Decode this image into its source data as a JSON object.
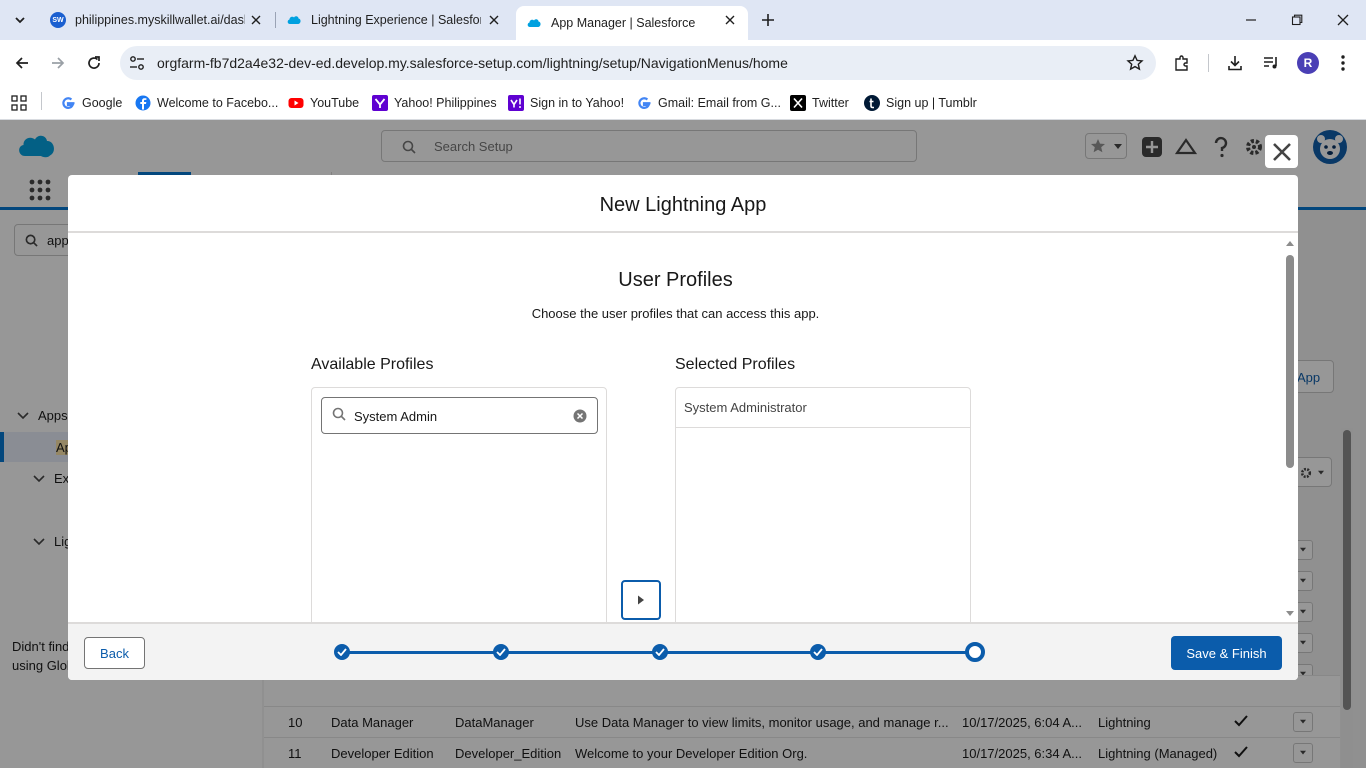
{
  "browser": {
    "tabs": [
      {
        "title": "philippines.myskillwallet.ai/dash",
        "favicon": "SW"
      },
      {
        "title": "Lightning Experience | Salesforce",
        "favicon": "salesforce-cloud"
      },
      {
        "title": "App Manager | Salesforce",
        "favicon": "salesforce-cloud"
      }
    ],
    "url": "orgfarm-fb7d2a4e32-dev-ed.develop.my.salesforce-setup.com/lightning/setup/NavigationMenus/home",
    "profile_initial": "R",
    "bookmarks": [
      {
        "label": "Google"
      },
      {
        "label": "Welcome to Facebo..."
      },
      {
        "label": "YouTube"
      },
      {
        "label": "Yahoo! Philippines"
      },
      {
        "label": "Sign in to Yahoo!"
      },
      {
        "label": "Gmail: Email from G..."
      },
      {
        "label": "Twitter"
      },
      {
        "label": "Sign up | Tumblr"
      }
    ]
  },
  "setup": {
    "search_placeholder": "Search Setup",
    "quick_find_value": "app",
    "left_items": [
      "Apps",
      "Ap",
      "Ext",
      "Lig"
    ],
    "didnt_find": [
      "Didn't find",
      "using Glol"
    ],
    "new_app_button": "App",
    "table_rows": [
      {
        "num": "10",
        "label": "Data Manager",
        "dev_name": "DataManager",
        "description": "Use Data Manager to view limits, monitor usage, and manage r...",
        "modified": "10/17/2025, 6:04 A...",
        "type": "Lightning"
      },
      {
        "num": "11",
        "label": "Developer Edition",
        "dev_name": "Developer_Edition",
        "description": "Welcome to your Developer Edition Org.",
        "modified": "10/17/2025, 6:34 A...",
        "type": "Lightning (Managed)"
      }
    ]
  },
  "modal": {
    "title": "New Lightning App",
    "step_title": "User Profiles",
    "step_description": "Choose the user profiles that can access this app.",
    "available_label": "Available Profiles",
    "selected_label": "Selected Profiles",
    "search_value": "System Admin",
    "selected_profiles": [
      "System Administrator"
    ],
    "back_label": "Back",
    "save_label": "Save & Finish",
    "progress": {
      "total_steps": 5,
      "current_step": 5
    }
  },
  "colors": {
    "brand_blue": "#0b5cab",
    "salesforce_cloud": "#00a1e0",
    "overlay": "rgba(8,7,7,0.42)"
  }
}
